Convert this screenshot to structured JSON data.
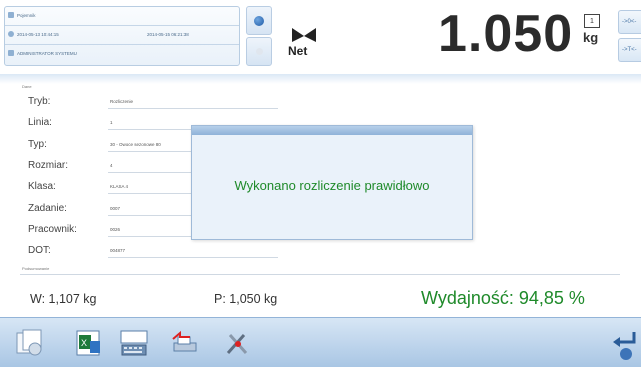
{
  "header": {
    "info_rows": [
      {
        "left": "Pojemnik",
        "right": ""
      },
      {
        "left": "2014-05-13 10:44:15",
        "right": "2014-05-15 06:21:38"
      },
      {
        "left": "ADMINISTRATOR SYSTEMU",
        "right": ""
      }
    ],
    "net_label": "Net",
    "weight": "1.050",
    "range_indicator": "1",
    "unit": "kg",
    "right_tabs": [
      "->0<-",
      "->T<-"
    ]
  },
  "fields": {
    "section_label": "Dane",
    "rows": [
      {
        "label": "Tryb:",
        "value": "Rozliczenie"
      },
      {
        "label": "Linia:",
        "value": "1"
      },
      {
        "label": "Typ:",
        "value": "30 - Owoce sezonowe 80"
      },
      {
        "label": "Rozmiar:",
        "value": "4"
      },
      {
        "label": "Klasa:",
        "value": "KLASA 4"
      },
      {
        "label": "Zadanie:",
        "value": "0007"
      },
      {
        "label": "Pracownik:",
        "value": "0026"
      },
      {
        "label": "DOT:",
        "value": "004877"
      }
    ]
  },
  "popup": {
    "message": "Wykonano rozliczenie prawidłowo"
  },
  "summary": {
    "section_label": "Podsumowanie",
    "w": "W: 1,107 kg",
    "p": "P: 1,050 kg",
    "yield": "Wydajność: 94,85 %"
  },
  "toolbar": {
    "buttons": [
      "records-icon",
      "excel-export-icon",
      "keyboard-icon",
      "scale-transfer-icon",
      "tools-icon"
    ],
    "return_icon": "return-icon"
  },
  "colors": {
    "accent": "#1f5aa6",
    "success": "#1f8a2a",
    "toolbar_bg": "#bcd4ec"
  }
}
